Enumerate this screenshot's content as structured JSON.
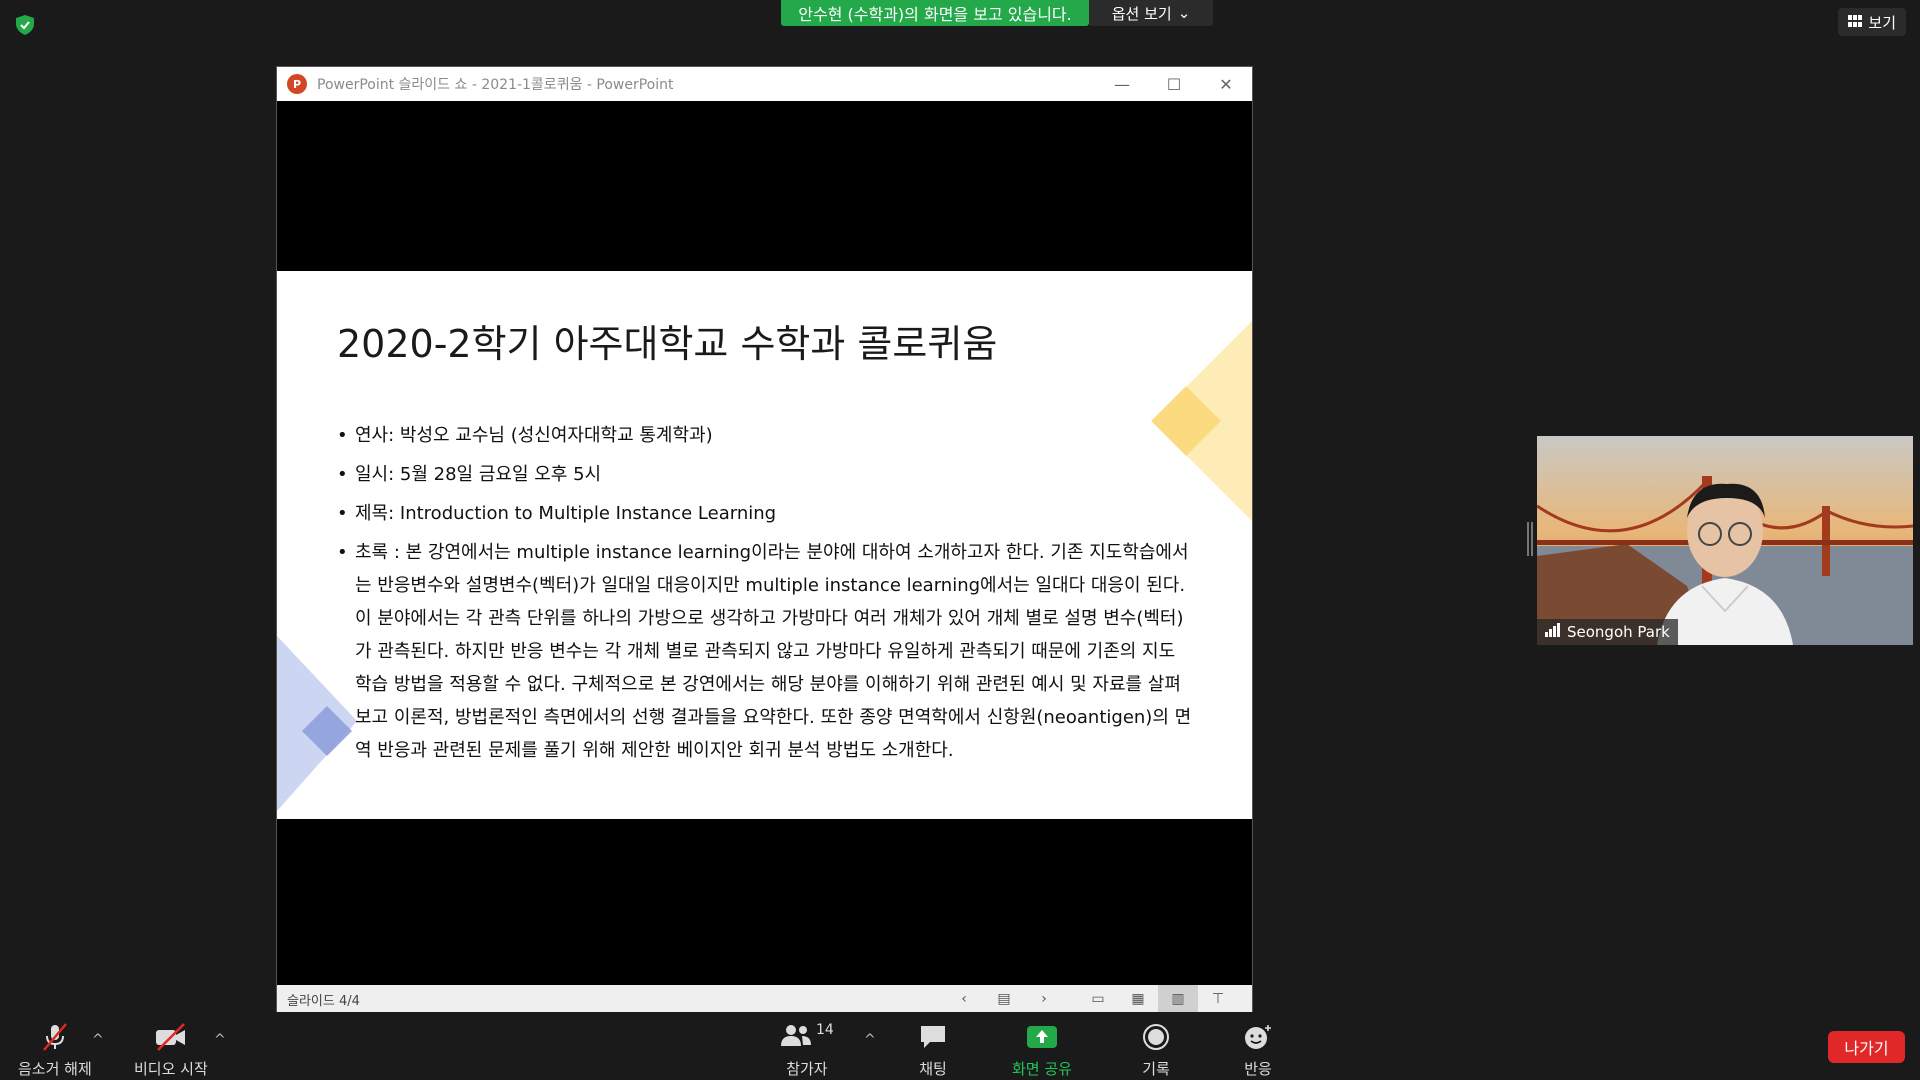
{
  "meeting": {
    "share_banner": "안수현 (수학과)의 화면을 보고 있습니다.",
    "view_options_label": "옵션 보기",
    "view_label": "보기",
    "security_icon": "shield-check-icon",
    "accent_green": "#23a94a",
    "leave_color": "#e02828"
  },
  "ppt_window": {
    "title": "PowerPoint 슬라이드 쇼  -  2021-1콜로퀴움 - PowerPoint",
    "logo_letter": "P",
    "status_text": "슬라이드 4/4"
  },
  "slide": {
    "title": "2020-2학기 아주대학교 수학과 콜로퀴움",
    "bullets": [
      "연사: 박성오 교수님 (성신여자대학교 통계학과)",
      "일시: 5월 28일 금요일 오후 5시",
      "제목: Introduction to Multiple Instance Learning",
      "초록 : 본 강연에서는 multiple instance learning이라는 분야에 대하여 소개하고자 한다. 기존 지도학습에서는 반응변수와 설명변수(벡터)가 일대일 대응이지만 multiple instance learning에서는 일대다 대응이 된다. 이 분야에서는 각 관측 단위를 하나의 가방으로 생각하고 가방마다 여러 개체가 있어 개체 별로 설명 변수(벡터)가 관측된다. 하지만 반응 변수는 각 개체 별로 관측되지 않고 가방마다 유일하게 관측되기 때문에 기존의 지도 학습 방법을 적용할 수 없다. 구체적으로 본 강연에서는 해당 분야를 이해하기 위해 관련된 예시 및 자료를 살펴보고 이론적, 방법론적인 측면에서의 선행 결과들을 요약한다. 또한 종양 면역학에서 신항원(neoantigen)의 면역 반응과 관련된 문제를 풀기 위해 제안한 베이지안 회귀 분석 방법도 소개한다."
    ]
  },
  "participant": {
    "name": "Seongoh Park"
  },
  "toolbar": {
    "unmute_label": "음소거 해제",
    "start_video_label": "비디오 시작",
    "participants_label": "참가자",
    "participants_count": "14",
    "chat_label": "채팅",
    "share_label": "화면 공유",
    "record_label": "기록",
    "reactions_label": "반응",
    "leave_label": "나가기"
  }
}
